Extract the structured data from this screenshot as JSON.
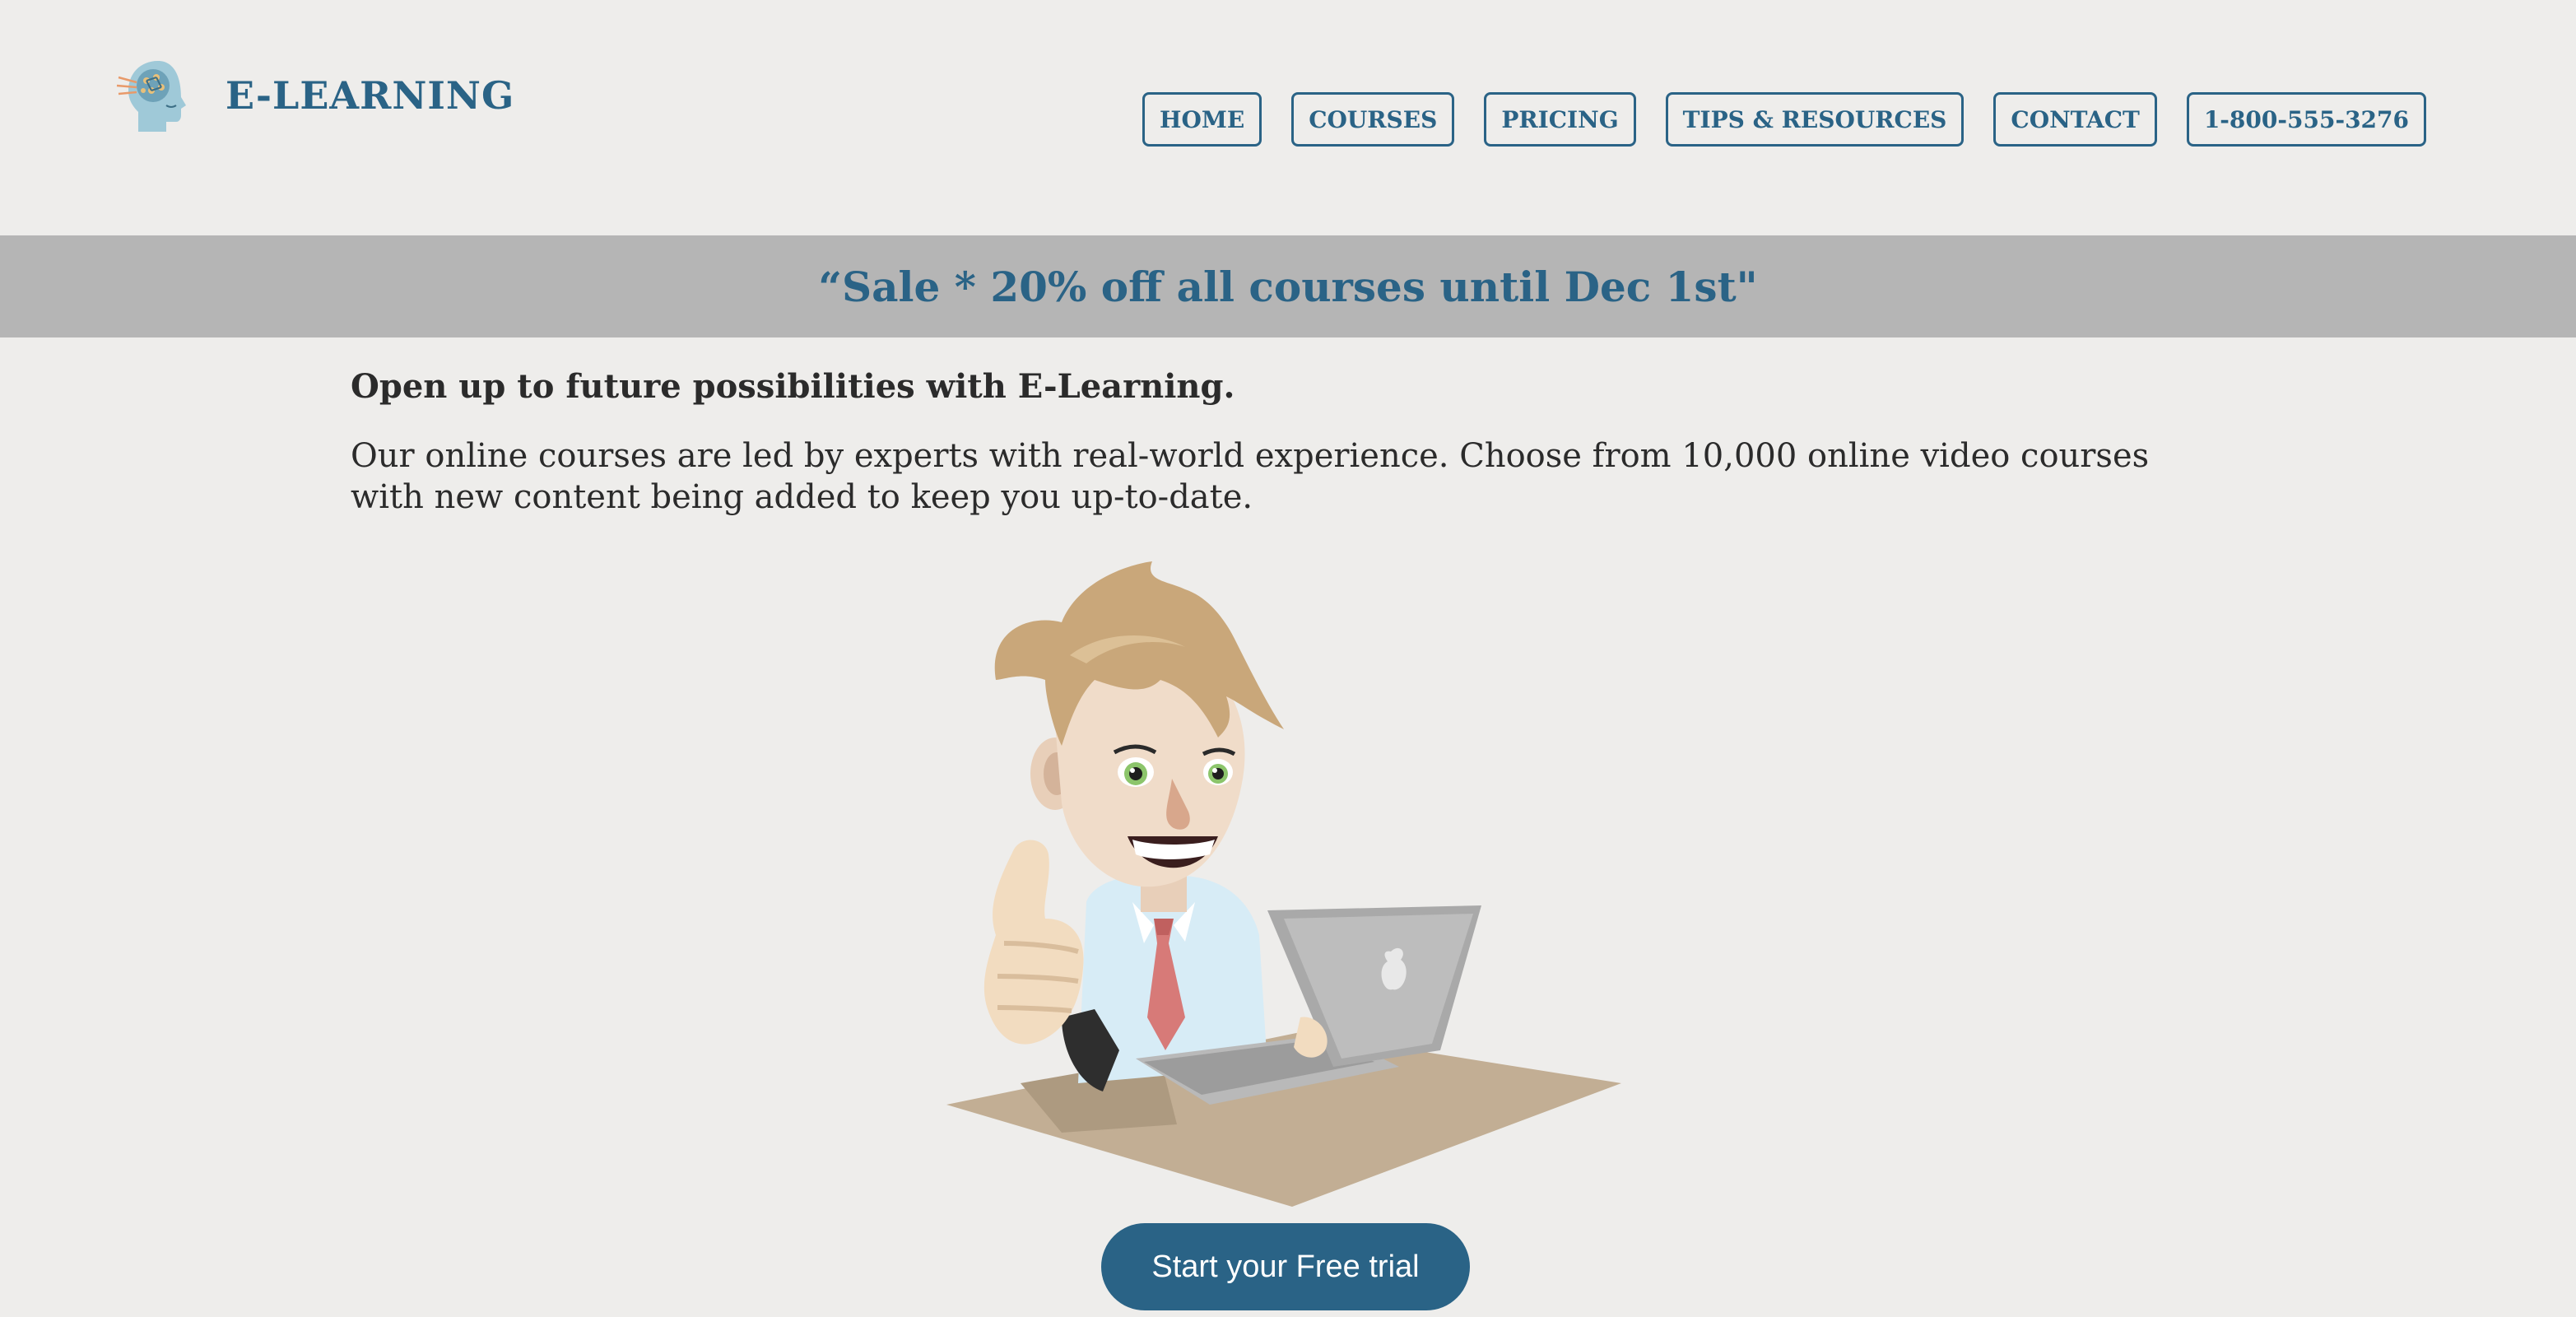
{
  "brand": {
    "name": "E-LEARNING",
    "logo_icon": "head-circuit-icon"
  },
  "nav": {
    "items": [
      {
        "label": "HOME"
      },
      {
        "label": "COURSES"
      },
      {
        "label": "PRICING"
      },
      {
        "label": "TIPS & RESOURCES"
      },
      {
        "label": "CONTACT"
      },
      {
        "label": "1-800-555-3276"
      }
    ]
  },
  "banner": {
    "text": "“Sale * 20% off all courses until Dec 1st\""
  },
  "main": {
    "headline": "Open up to future possibilities with E-Learning.",
    "description": "Our online courses are led by experts with real-world experience. Choose from 10,000 online video courses with new content being added to keep you up-to-date.",
    "illustration_icon": "cartoon-man-laptop-thumbs-up",
    "cta_label": "Start your Free trial"
  },
  "colors": {
    "brand": "#2a6386",
    "background": "#eeedeb",
    "banner_bg": "#b5b5b5",
    "text": "#2b2b2b"
  }
}
